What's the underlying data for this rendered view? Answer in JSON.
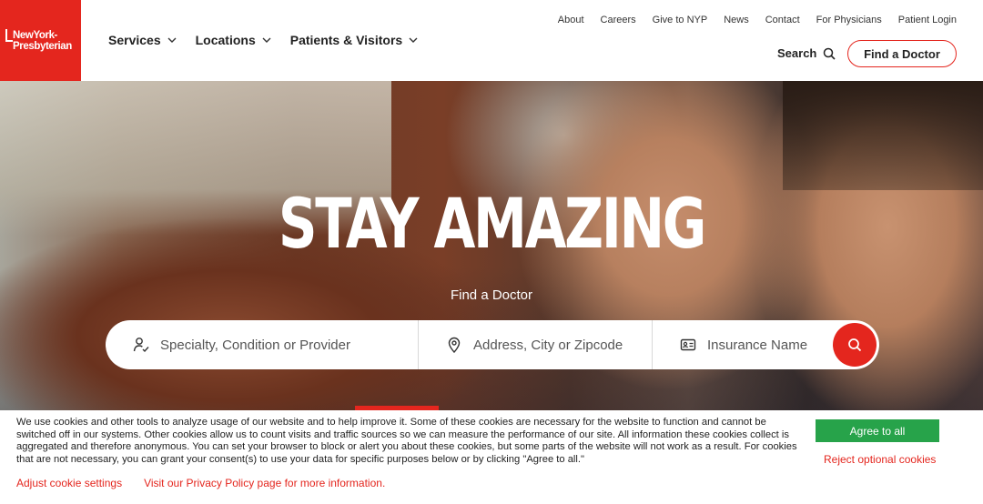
{
  "brand": {
    "name_line1": "NewYork-",
    "name_line2": "Presbyterian",
    "color": "#e4261e"
  },
  "main_nav": [
    {
      "label": "Services",
      "icon": "chevron-down-icon"
    },
    {
      "label": "Locations",
      "icon": "chevron-down-icon"
    },
    {
      "label": "Patients & Visitors",
      "icon": "chevron-down-icon"
    }
  ],
  "utility_nav": [
    "About",
    "Careers",
    "Give to NYP",
    "News",
    "Contact",
    "For Physicians",
    "Patient Login"
  ],
  "header_actions": {
    "search_label": "Search",
    "find_doctor_label": "Find a Doctor"
  },
  "hero": {
    "headline": "STAY AMAZING",
    "subheading": "Find a Doctor"
  },
  "search_form": {
    "specialty_placeholder": "Specialty, Condition or Provider",
    "location_placeholder": "Address, City or Zipcode",
    "insurance_placeholder": "Insurance Name",
    "submit_icon": "search-icon"
  },
  "cookie_banner": {
    "message": "We use cookies and other tools to analyze usage of our website and to help improve it. Some of these cookies are necessary for the website to function and cannot be switched off in our systems. Other cookies allow us to count visits and traffic sources so we can measure the performance of our site. All information these cookies collect is aggregated and therefore anonymous. You can set your browser to block or alert you about these cookies, but some parts of the website will not work as a result. For cookies that are not necessary, you can grant your consent(s) to use your data for specific purposes below or by clicking \"Agree to all.\"",
    "agree_label": "Agree to all",
    "reject_label": "Reject optional cookies",
    "adjust_label": "Adjust cookie settings",
    "privacy_label": "Visit our Privacy Policy page for more information.",
    "agree_color": "#27a34a"
  }
}
